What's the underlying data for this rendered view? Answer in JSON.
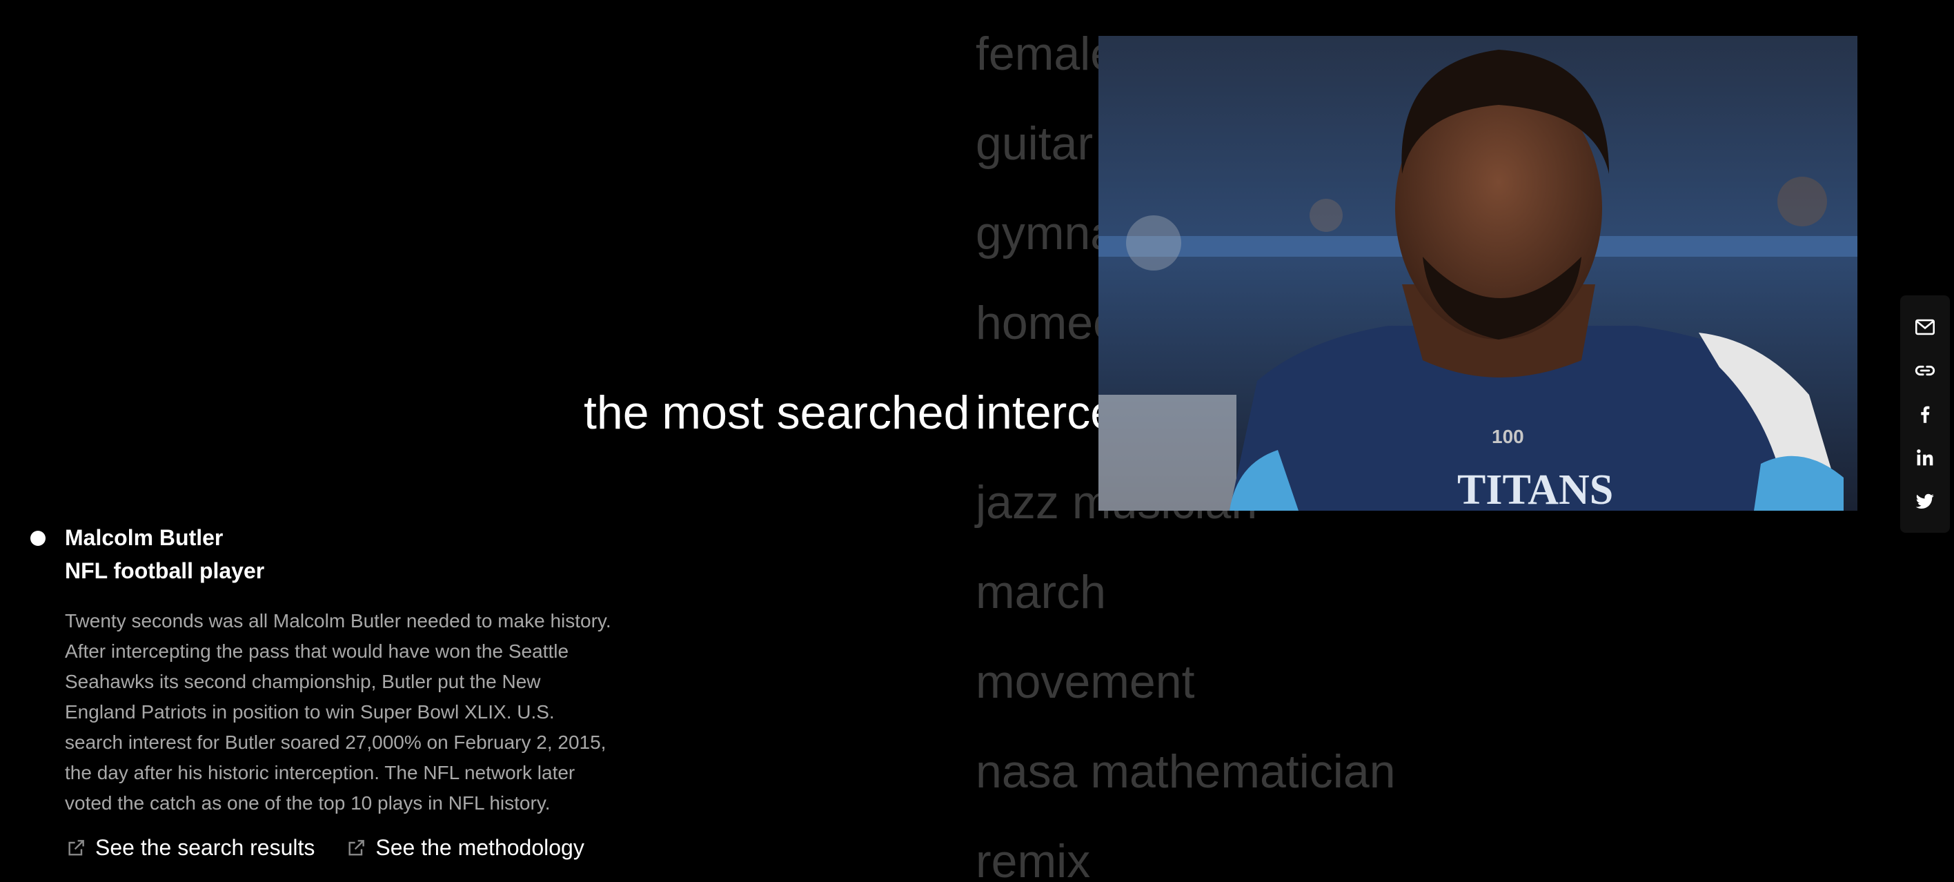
{
  "lead_phrase": "the most searched",
  "words": [
    {
      "label": "female",
      "active": false
    },
    {
      "label": "guitar",
      "active": false
    },
    {
      "label": "gymnast",
      "active": false
    },
    {
      "label": "homecoming",
      "active": false
    },
    {
      "label": "interception",
      "active": true
    },
    {
      "label": "jazz musician",
      "active": false
    },
    {
      "label": "march",
      "active": false
    },
    {
      "label": "movement",
      "active": false
    },
    {
      "label": "nasa mathematician",
      "active": false
    },
    {
      "label": "remix",
      "active": false
    }
  ],
  "photo": {
    "jersey_text": "TITANS",
    "patch_text": "100"
  },
  "share": [
    {
      "icon": "mail-icon",
      "name": "share-email-button"
    },
    {
      "icon": "link-icon",
      "name": "share-link-button"
    },
    {
      "icon": "facebook-icon",
      "name": "share-facebook-button"
    },
    {
      "icon": "linkedin-icon",
      "name": "share-linkedin-button"
    },
    {
      "icon": "twitter-icon",
      "name": "share-twitter-button"
    }
  ],
  "person": {
    "name": "Malcolm Butler",
    "role": "NFL football player",
    "description": "Twenty seconds was all Malcolm Butler needed to make history. After intercepting the pass that would have won the Seattle Seahawks its second championship, Butler put the New England Patriots in position to win Super Bowl XLIX. U.S. search interest for Butler soared 27,000% on February 2, 2015, the day after his historic interception. The NFL network later voted the catch as one of the top 10 plays in NFL history."
  },
  "links": {
    "search_results": "See the search results",
    "methodology": "See the methodology"
  },
  "colors": {
    "background": "#000000",
    "inactive_word": "#3a3a3a",
    "active_word": "#ffffff",
    "body_text": "#a8a8a8"
  }
}
